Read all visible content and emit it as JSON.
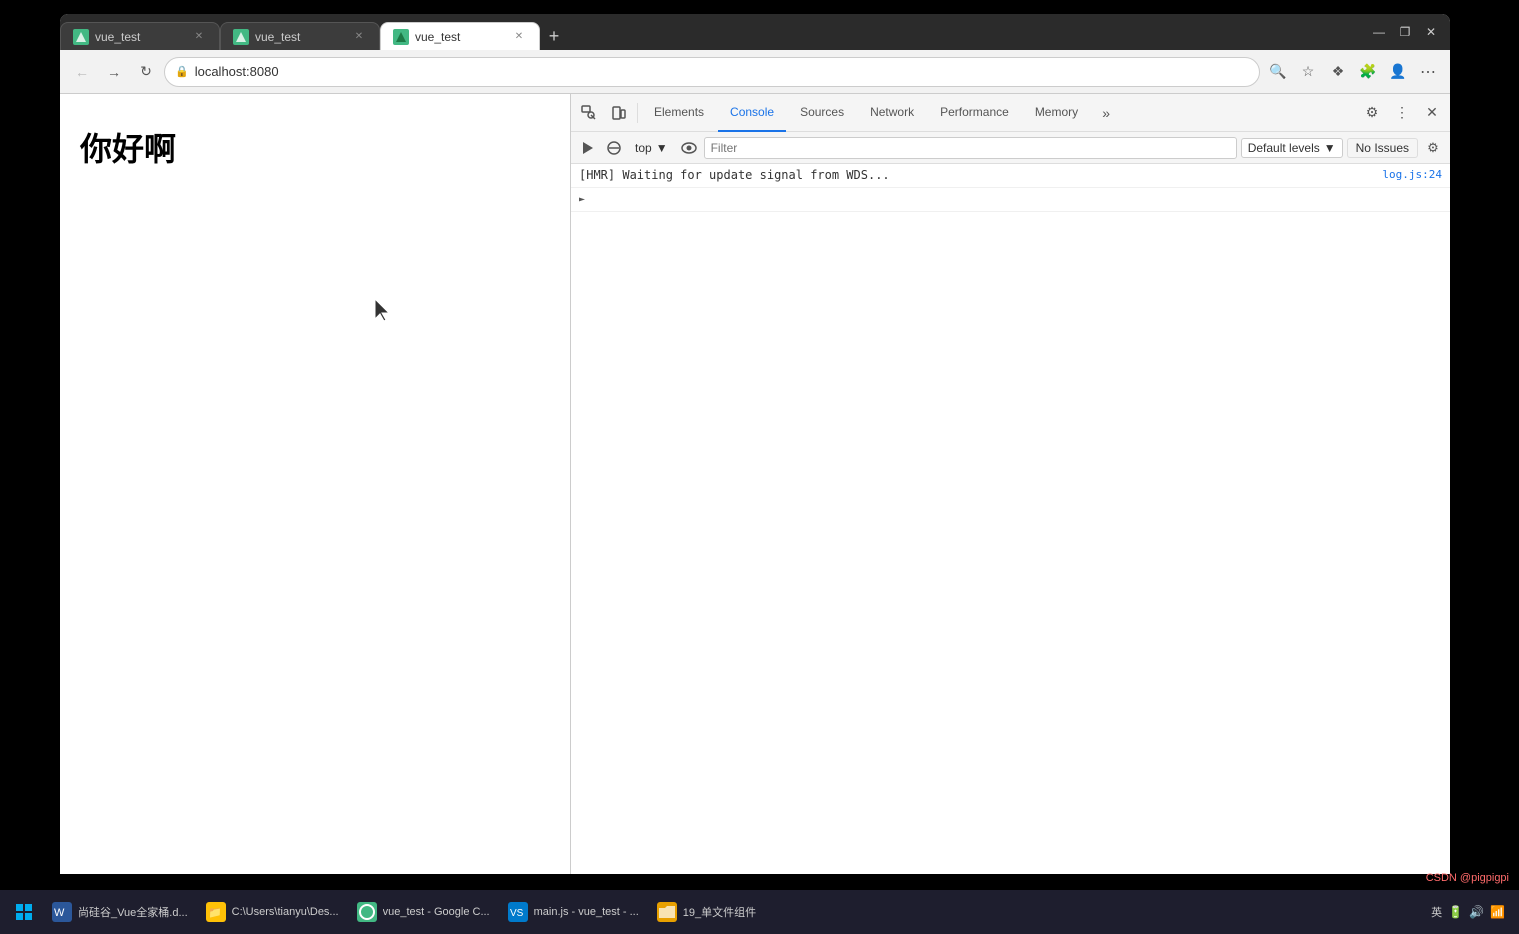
{
  "browser": {
    "tabs": [
      {
        "id": "tab1",
        "label": "vue_test",
        "favicon_color": "#42b883",
        "active": false
      },
      {
        "id": "tab2",
        "label": "vue_test",
        "favicon_color": "#42b883",
        "active": false
      },
      {
        "id": "tab3",
        "label": "vue_test",
        "favicon_color": "#42b883",
        "active": true
      }
    ],
    "address": "localhost:8080",
    "window_controls": {
      "minimize": "—",
      "restore": "❐",
      "close": "✕"
    }
  },
  "page": {
    "heading": "你好啊"
  },
  "devtools": {
    "tabs": [
      {
        "id": "elements",
        "label": "Elements",
        "active": false
      },
      {
        "id": "console",
        "label": "Console",
        "active": true
      },
      {
        "id": "sources",
        "label": "Sources",
        "active": false
      },
      {
        "id": "network",
        "label": "Network",
        "active": false
      },
      {
        "id": "performance",
        "label": "Performance",
        "active": false
      },
      {
        "id": "memory",
        "label": "Memory",
        "active": false
      }
    ],
    "console": {
      "context": "top",
      "filter_placeholder": "Filter",
      "levels": "Default levels",
      "no_issues": "No Issues",
      "messages": [
        {
          "text": "[HMR] Waiting for update signal from WDS...",
          "source": "log.js:24",
          "has_expand": false
        }
      ],
      "expand_row": {
        "has_expand": true
      }
    }
  },
  "taskbar": {
    "items": [
      {
        "id": "word",
        "label": "尚硅谷_Vue全家桶.d...",
        "icon_color": "#2b579a"
      },
      {
        "id": "explorer",
        "label": "C:\\Users\\tianyu\\Des...",
        "icon_color": "#ffc107"
      },
      {
        "id": "chrome",
        "label": "vue_test - Google C...",
        "icon_color": "#42b883"
      },
      {
        "id": "vscode1",
        "label": "main.js - vue_test - ...",
        "icon_color": "#007acc"
      },
      {
        "id": "folder",
        "label": "19_单文件组件",
        "icon_color": "#ffc107"
      }
    ],
    "sys_icons": [
      "英",
      "⌨",
      "🔊"
    ],
    "watermark": "CSDN @pigpigpi"
  }
}
